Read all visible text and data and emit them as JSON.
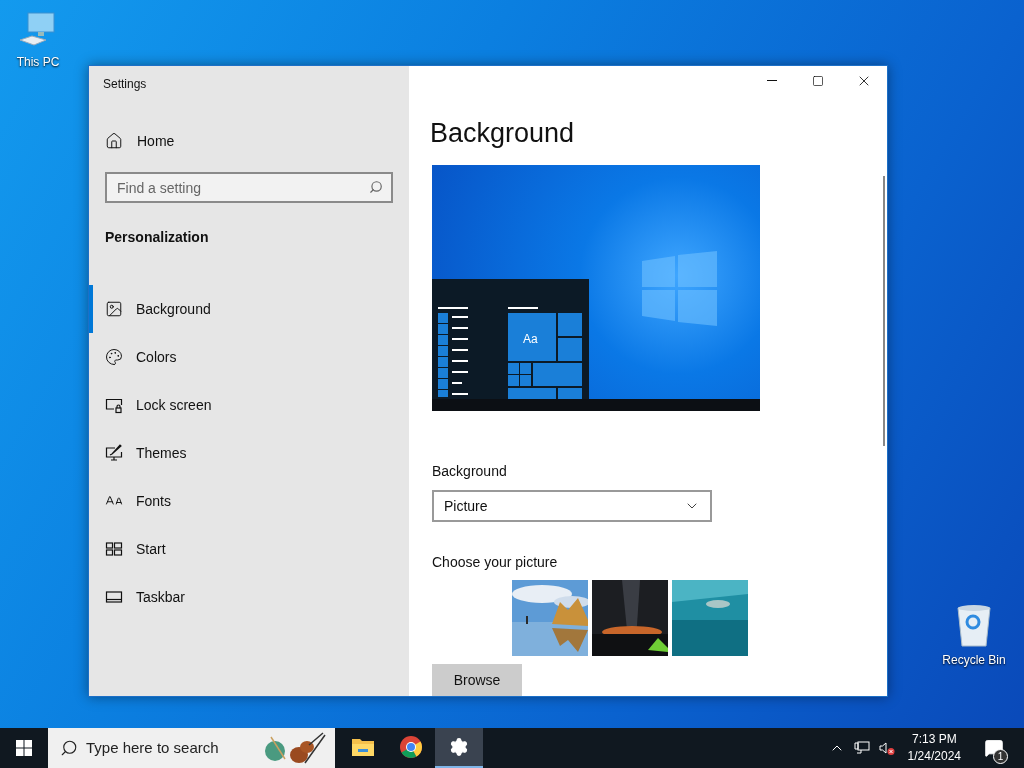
{
  "desktop_icons": [
    {
      "label": "This PC",
      "kind": "pc"
    },
    {
      "label": "Recycle Bin",
      "kind": "bin"
    }
  ],
  "window": {
    "title": "Settings",
    "home": "Home",
    "search": {
      "placeholder": "Find a setting"
    },
    "section": "Personalization",
    "nav": [
      {
        "label": "Background",
        "kind": "picture",
        "selected": true
      },
      {
        "label": "Colors",
        "kind": "palette",
        "selected": false
      },
      {
        "label": "Lock screen",
        "kind": "lock",
        "selected": false
      },
      {
        "label": "Themes",
        "kind": "themes",
        "selected": false
      },
      {
        "label": "Fonts",
        "kind": "fonts",
        "selected": false
      },
      {
        "label": "Start",
        "kind": "start",
        "selected": false
      },
      {
        "label": "Taskbar",
        "kind": "taskbar",
        "selected": false
      }
    ],
    "page_title": "Background",
    "preview": {
      "tile_text": "Aa"
    },
    "background_select": {
      "label": "Background",
      "value": "Picture"
    },
    "choose_label": "Choose your picture",
    "browse": "Browse"
  },
  "taskbar": {
    "search_placeholder": "Type here to search",
    "apps": [
      {
        "kind": "explorer",
        "selected": false
      },
      {
        "kind": "chrome",
        "selected": false
      },
      {
        "kind": "settings",
        "selected": true
      }
    ],
    "time": "7:13 PM",
    "date": "1/24/2024",
    "notifications": "1"
  }
}
